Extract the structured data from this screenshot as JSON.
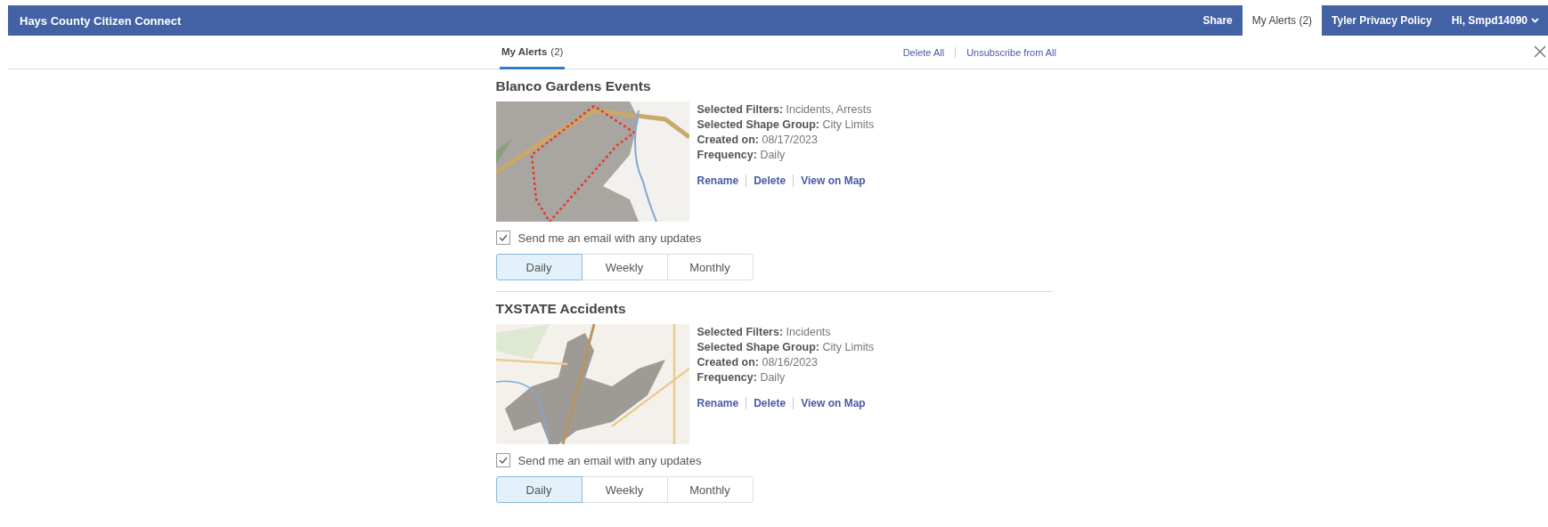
{
  "header": {
    "title": "Hays County Citizen Connect",
    "nav": [
      {
        "label": "Share",
        "selected": false
      },
      {
        "label": "My Alerts (2)",
        "selected": true
      },
      {
        "label": "Tyler Privacy Policy",
        "selected": false
      }
    ],
    "user_menu": "Hi, Smpd14090"
  },
  "subheader": {
    "tabs": [
      {
        "label": "My Alerts",
        "count": "(2)",
        "selected": true
      }
    ],
    "actions": [
      "Delete All",
      "Unsubscribe from All"
    ]
  },
  "alerts": [
    {
      "title": "Blanco Gardens Events",
      "map": {
        "kind": "shape"
      },
      "details": [
        {
          "label": "Selected Filters:",
          "value": "Incidents, Arrests"
        },
        {
          "label": "Selected Shape Group:",
          "value": "City Limits"
        },
        {
          "label": "Created on:",
          "value": "08/17/2023"
        },
        {
          "label": "Frequency:",
          "value": "Daily"
        }
      ],
      "links": [
        "Rename",
        "Delete",
        "View on Map"
      ],
      "email": {
        "label": "Send me an email with any updates",
        "checked": true
      },
      "frequency": [
        {
          "label": "Daily",
          "selected": true
        },
        {
          "label": "Weekly",
          "selected": false
        },
        {
          "label": "Monthly",
          "selected": false
        }
      ]
    },
    {
      "title": "TXSTATE Accidents",
      "map": {
        "kind": "city"
      },
      "details": [
        {
          "label": "Selected Filters:",
          "value": "Incidents"
        },
        {
          "label": "Selected Shape Group:",
          "value": "City Limits"
        },
        {
          "label": "Created on:",
          "value": "08/16/2023"
        },
        {
          "label": "Frequency:",
          "value": "Daily"
        }
      ],
      "links": [
        "Rename",
        "Delete",
        "View on Map"
      ],
      "email": {
        "label": "Send me an email with any updates",
        "checked": true
      },
      "frequency": [
        {
          "label": "Daily",
          "selected": true
        },
        {
          "label": "Weekly",
          "selected": false
        },
        {
          "label": "Monthly",
          "selected": false
        }
      ]
    }
  ]
}
